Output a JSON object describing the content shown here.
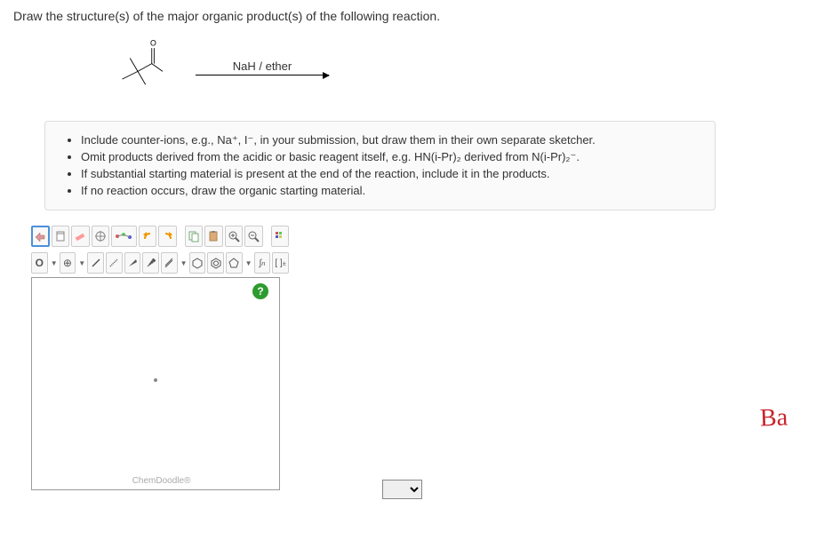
{
  "question": "Draw the structure(s) of the major organic product(s) of the following reaction.",
  "reaction": {
    "reagent_text": "NaH / ether"
  },
  "instructions": [
    "Include counter-ions, e.g., Na⁺, I⁻, in your submission, but draw them in their own separate sketcher.",
    "Omit products derived from the acidic or basic reagent itself, e.g. HN(i-Pr)₂ derived from N(i-Pr)₂⁻.",
    "If substantial starting material is present at the end of the reaction, include it in the products.",
    "If no reaction occurs, draw the organic starting material."
  ],
  "toolbar": {
    "row1": {
      "move": "✋",
      "clipboard": "📋",
      "erase": "✏",
      "center": "✱",
      "clean": "⚛",
      "lasso": "⬭",
      "undo": "↶",
      "redo": "↷",
      "copy": "⿻",
      "paste": "📄",
      "zoomin": "🔍+",
      "zoomout": "🔍−",
      "settings": "⚙"
    },
    "row2": {
      "element": "O",
      "charge": "⊕",
      "single": "/",
      "recess": "⋰",
      "wedge": "◢",
      "dashwedge": "⫽",
      "double": "⫫",
      "benz": "⬡",
      "nitro": "⬡",
      "chain": "⬠",
      "query": "∫n",
      "bracket": "[ ]ⁿ"
    }
  },
  "canvas": {
    "help": "?",
    "watermark": "ChemDoodle®"
  },
  "handwriting": "Ba"
}
